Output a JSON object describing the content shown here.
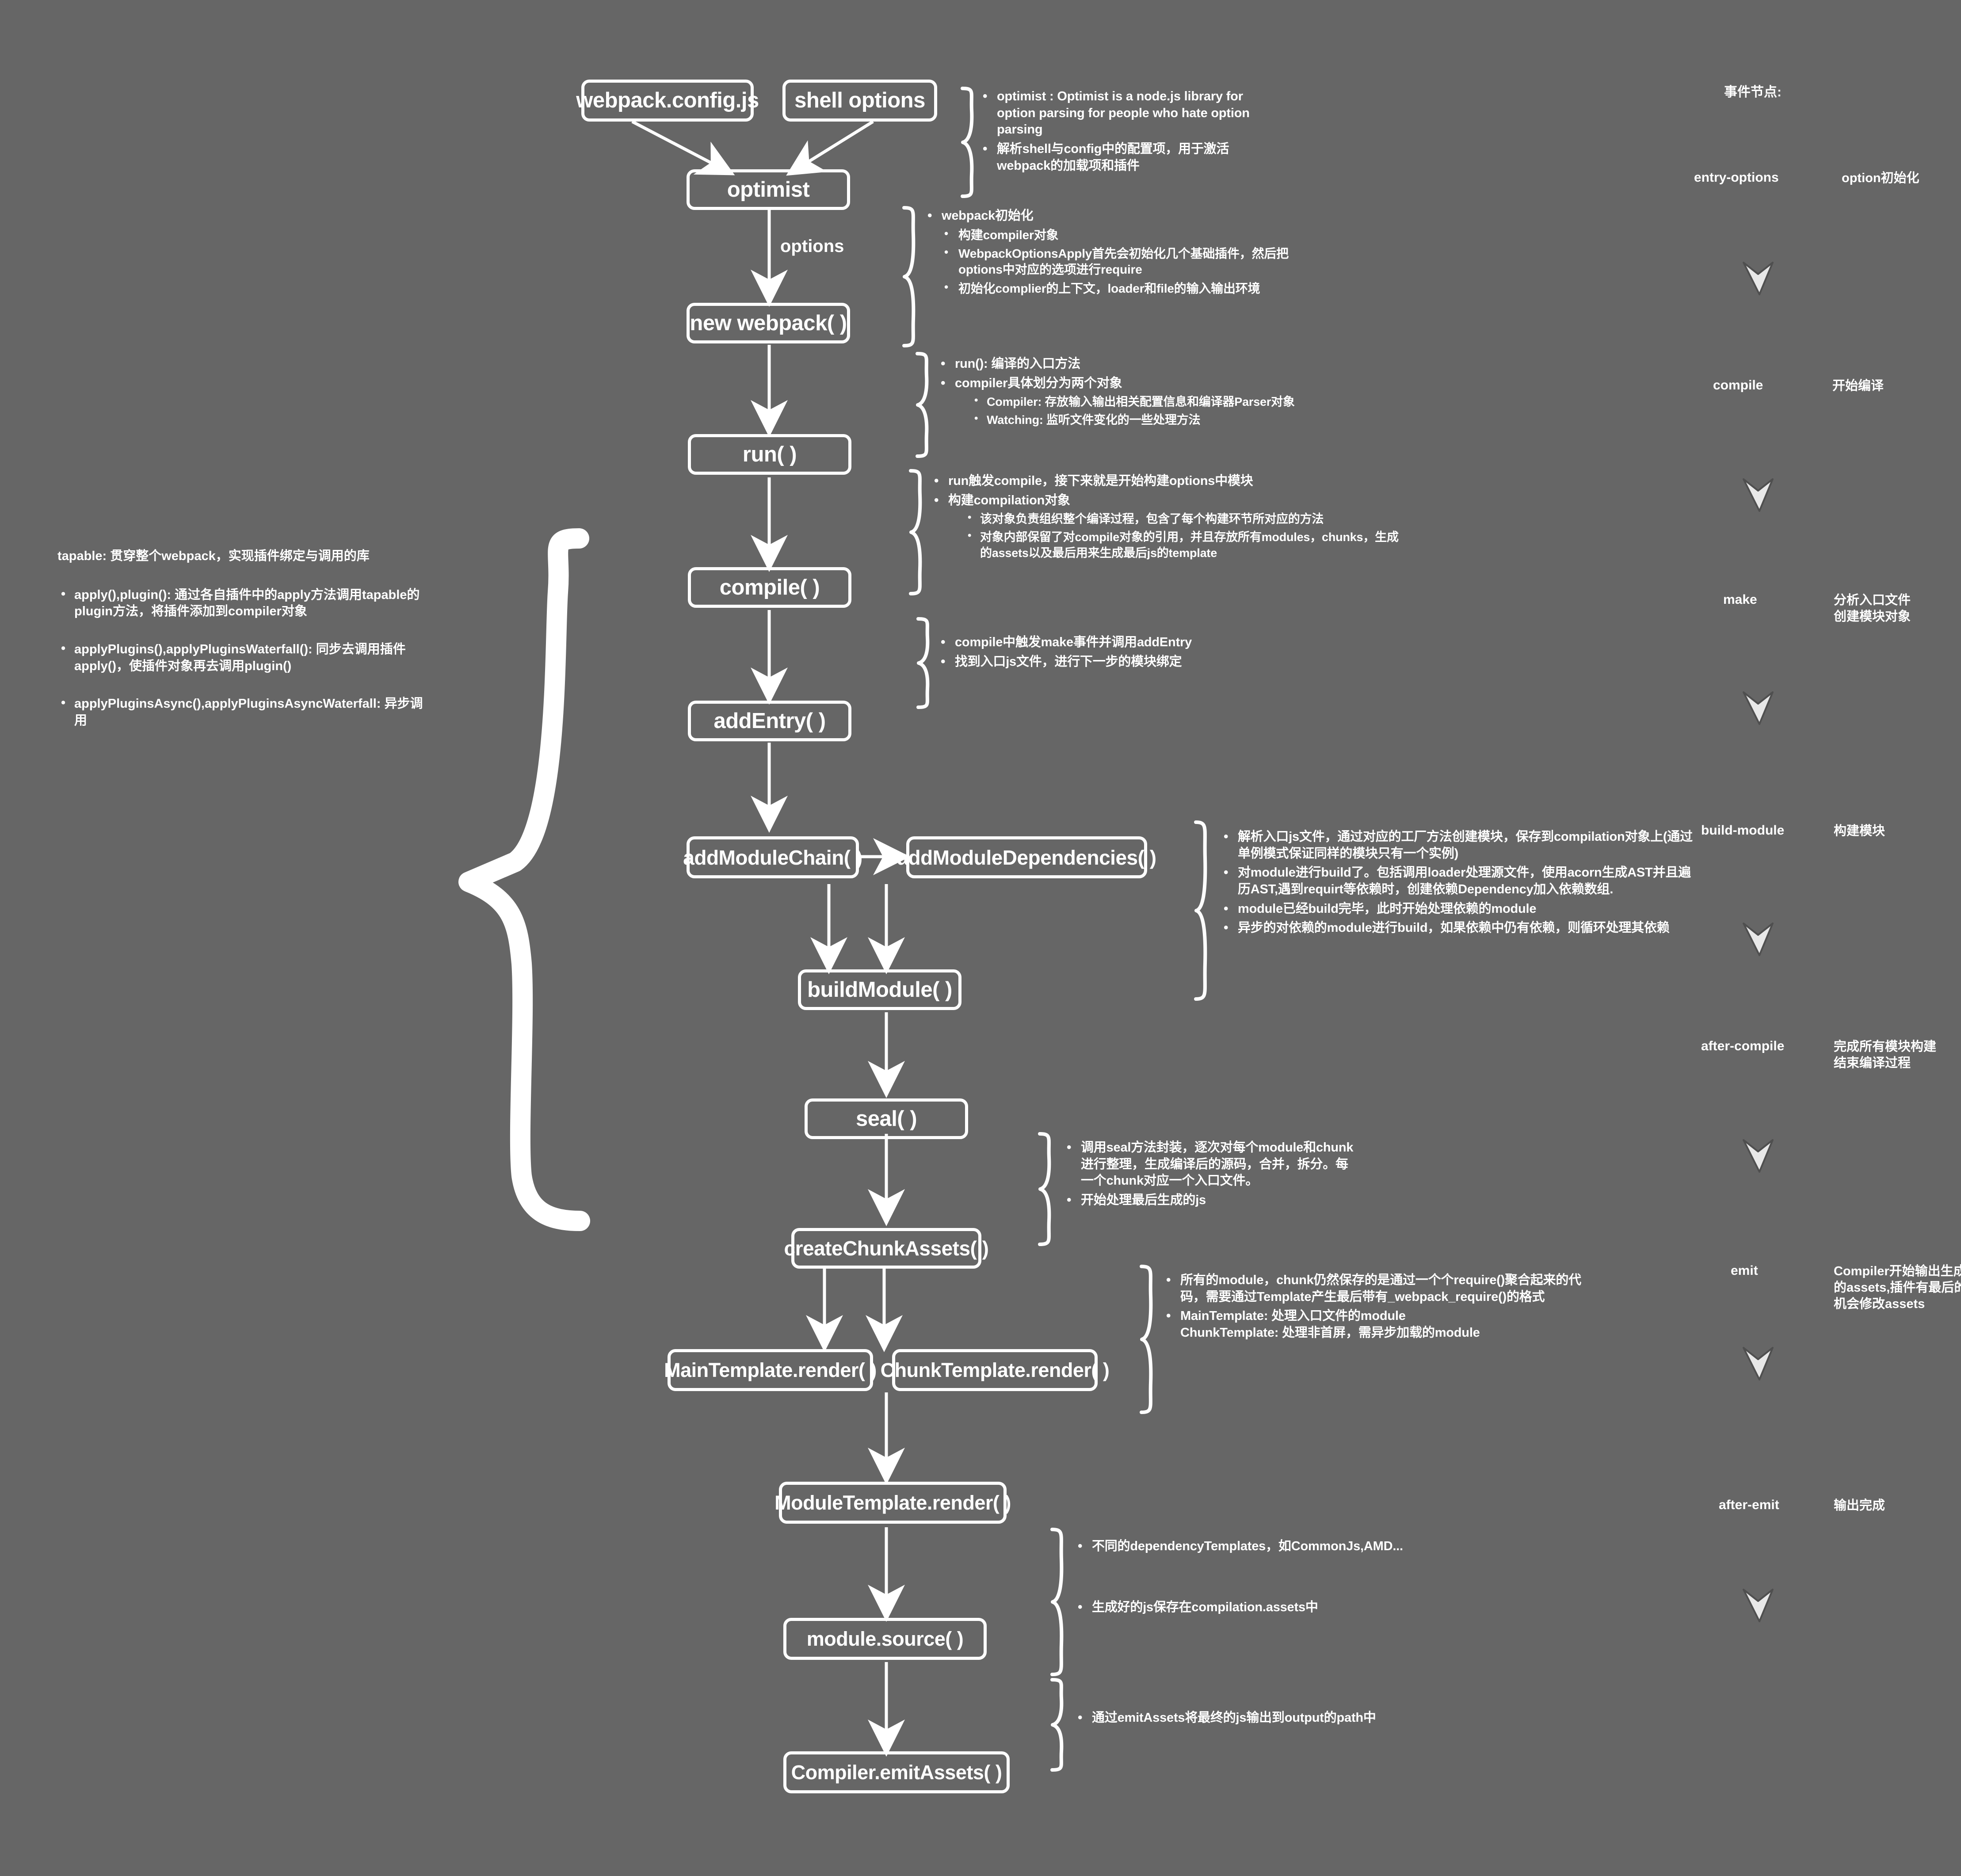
{
  "theme": {
    "background": "#666666",
    "stroke": "#ffffff",
    "text": "#ffffff",
    "chevron_fill": "#e8e8e8"
  },
  "flow": {
    "nodes": [
      {
        "id": "webpack-config",
        "label": "webpack.config.js"
      },
      {
        "id": "shell-options",
        "label": "shell options"
      },
      {
        "id": "optimist",
        "label": "optimist"
      },
      {
        "id": "new-webpack",
        "label": "new webpack( )"
      },
      {
        "id": "run",
        "label": "run( )"
      },
      {
        "id": "compile",
        "label": "compile( )"
      },
      {
        "id": "add-entry",
        "label": "addEntry( )"
      },
      {
        "id": "add-module-chain",
        "label": "addModuleChain( )"
      },
      {
        "id": "add-module-deps",
        "label": "addModuleDependencies( )"
      },
      {
        "id": "build-module",
        "label": "buildModule( )"
      },
      {
        "id": "seal",
        "label": "seal( )"
      },
      {
        "id": "create-chunk-assets",
        "label": "createChunkAssets( )"
      },
      {
        "id": "main-template-render",
        "label": "MainTemplate.render( )"
      },
      {
        "id": "chunk-template-render",
        "label": "ChunkTemplate.render( )"
      },
      {
        "id": "module-template-render",
        "label": "ModuleTemplate.render( )"
      },
      {
        "id": "module-source",
        "label": "module.source( )"
      },
      {
        "id": "compiler-emit-assets",
        "label": "Compiler.emitAssets( )"
      }
    ],
    "edge_label_options": "options"
  },
  "tapable": {
    "heading": "tapable: 贯穿整个webpack，实现插件绑定与调用的库",
    "items": [
      "apply(),plugin(): 通过各自插件中的apply方法调用tapable的plugin方法，将插件添加到compiler对象",
      "applyPlugins(),applyPluginsWaterfall(): 同步去调用插件apply()，使插件对象再去调用plugin()",
      "applyPluginsAsync(),applyPluginsAsyncWaterfall: 异步调用"
    ]
  },
  "annotations": {
    "optimist": [
      {
        "level": 1,
        "text": "optimist : Optimist is a node.js library for option parsing for people who hate option parsing"
      },
      {
        "level": 1,
        "text": "解析shell与config中的配置项，用于激活webpack的加载项和插件"
      }
    ],
    "new_webpack": [
      {
        "level": 1,
        "text": "webpack初始化"
      },
      {
        "level": 2,
        "text": "构建compiler对象"
      },
      {
        "level": 2,
        "text": "WebpackOptionsApply首先会初始化几个基础插件，然后把options中对应的选项进行require"
      },
      {
        "level": 2,
        "text": "初始化complier的上下文，loader和file的输入输出环境"
      }
    ],
    "run": [
      {
        "level": 1,
        "text": "run(): 编译的入口方法"
      },
      {
        "level": 1,
        "text": "compiler具体划分为两个对象"
      },
      {
        "level": 3,
        "text": "Compiler: 存放输入输出相关配置信息和编译器Parser对象"
      },
      {
        "level": 3,
        "text": "Watching: 监听文件变化的一些处理方法"
      }
    ],
    "compile": [
      {
        "level": 1,
        "text": "run触发compile，接下来就是开始构建options中模块"
      },
      {
        "level": 1,
        "text": "构建compilation对象"
      },
      {
        "level": 3,
        "text": "该对象负责组织整个编译过程，包含了每个构建环节所对应的方法"
      },
      {
        "level": 3,
        "text": "对象内部保留了对compile对象的引用，并且存放所有modules，chunks，生成的assets以及最后用来生成最后js的template"
      }
    ],
    "add_entry": [
      {
        "level": 1,
        "text": "compile中触发make事件并调用addEntry"
      },
      {
        "level": 1,
        "text": "找到入口js文件，进行下一步的模块绑定"
      }
    ],
    "build_module": [
      {
        "level": 1,
        "text": "解析入口js文件，通过对应的工厂方法创建模块，保存到compilation对象上(通过单例模式保证同样的模块只有一个实例)"
      },
      {
        "level": 1,
        "text": "对module进行build了。包括调用loader处理源文件，使用acorn生成AST并且遍历AST,遇到requirt等依赖时，创建依赖Dependency加入依赖数组."
      },
      {
        "level": 1,
        "text": "module已经build完毕，此时开始处理依赖的module"
      },
      {
        "level": 1,
        "text": "异步的对依赖的module进行build，如果依赖中仍有依赖，则循环处理其依赖"
      }
    ],
    "seal": [
      {
        "level": 1,
        "text": "调用seal方法封装，逐次对每个module和chunk进行整理，生成编译后的源码，合并，拆分。每一个chunk对应一个入口文件。"
      },
      {
        "level": 1,
        "text": "开始处理最后生成的js"
      }
    ],
    "create_chunk_assets": [
      {
        "level": 1,
        "text": "所有的module，chunk仍然保存的是通过一个个require()聚合起来的代码，需要通过Template产生最后带有_webpack_require()的格式"
      },
      {
        "level": 1,
        "text": "MainTemplate: 处理入口文件的module\nChunkTemplate: 处理非首屏，需异步加载的module"
      }
    ],
    "module_template": [
      {
        "level": 1,
        "text": "不同的dependencyTemplates，如CommonJs,AMD..."
      },
      {
        "level": 1,
        "text": "生成好的js保存在compilation.assets中"
      }
    ],
    "emit_assets": [
      {
        "level": 1,
        "text": "通过emitAssets将最终的js输出到output的path中"
      }
    ]
  },
  "events": {
    "title": "事件节点:",
    "items": [
      {
        "name": "entry-options",
        "desc": "option初始化"
      },
      {
        "name": "compile",
        "desc": "开始编译"
      },
      {
        "name": "make",
        "desc": "分析入口文件\n创建模块对象"
      },
      {
        "name": "build-module",
        "desc": "构建模块"
      },
      {
        "name": "after-compile",
        "desc": "完成所有模块构建\n结束编译过程"
      },
      {
        "name": "emit",
        "desc": "Compiler开始输出生成的assets,插件有最后的机会修改assets"
      },
      {
        "name": "after-emit",
        "desc": "输出完成"
      }
    ]
  }
}
